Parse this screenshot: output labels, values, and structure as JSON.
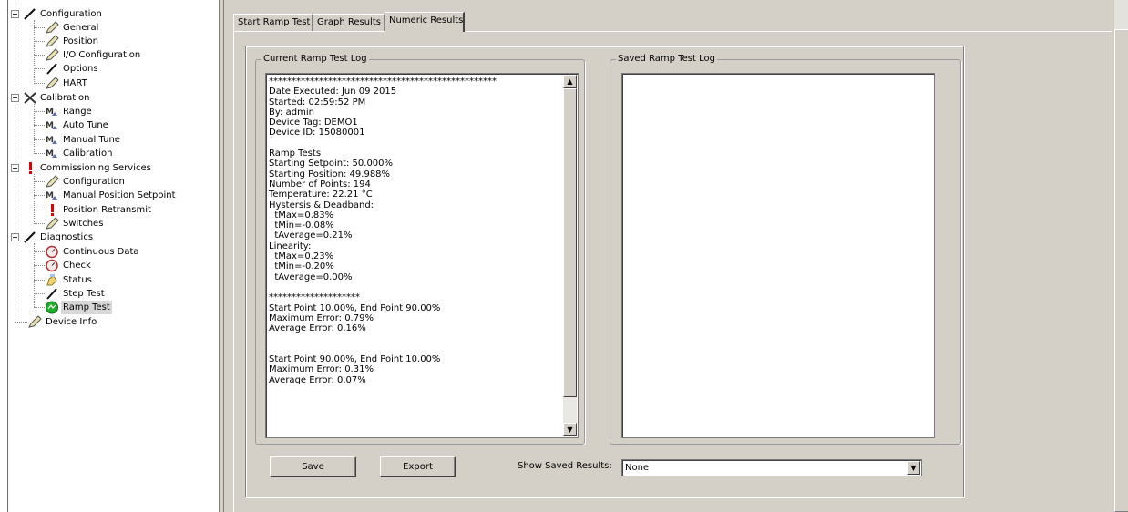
{
  "tree": {
    "configuration": {
      "label": "Configuration",
      "children": [
        "General",
        "Position",
        "I/O Configuration",
        "Options",
        "HART"
      ]
    },
    "calibration": {
      "label": "Calibration",
      "children": [
        "Range",
        "Auto Tune",
        "Manual Tune",
        "Calibration"
      ]
    },
    "commissioning": {
      "label": "Commissioning Services",
      "children": [
        "Configuration",
        "Manual Position Setpoint",
        "Position Retransmit",
        "Switches"
      ]
    },
    "diagnostics": {
      "label": "Diagnostics",
      "children": [
        "Continuous Data",
        "Check",
        "Status",
        "Step Test",
        "Ramp Test"
      ]
    },
    "device_info": "Device Info",
    "selected": "Ramp Test"
  },
  "tabs": [
    "Start Ramp Test",
    "Graph Results",
    "Numeric Results"
  ],
  "active_tab": "Numeric Results",
  "current_log": {
    "title": "Current Ramp Test Log",
    "text": "**************************************************\nDate Executed: Jun 09 2015\nStarted: 02:59:52 PM\nBy: admin\nDevice Tag: DEMO1\nDevice ID: 15080001\n\nRamp Tests\nStarting Setpoint: 50.000%\nStarting Position: 49.988%\nNumber of Points: 194\nTemperature: 22.21 °C\nHystersis & Deadband:\n  tMax=0.83%\n  tMin=-0.08%\n  tAverage=0.21%\nLinearity:\n  tMax=0.23%\n  tMin=-0.20%\n  tAverage=0.00%\n\n********************\nStart Point 10.00%, End Point 90.00%\nMaximum Error: 0.79%\nAverage Error: 0.16%\n\n\nStart Point 90.00%, End Point 10.00%\nMaximum Error: 0.31%\nAverage Error: 0.07%"
  },
  "saved_log": {
    "title": "Saved Ramp Test Log",
    "text": ""
  },
  "buttons": {
    "save": "Save",
    "export": "Export"
  },
  "show_saved": {
    "label": "Show Saved Results:",
    "value": "None"
  },
  "colors": {
    "window_bg": "#d4d0c8",
    "selection_bg": "#d7d7d7",
    "alert_red": "#e00000",
    "ramp_green": "#1fae2a"
  }
}
